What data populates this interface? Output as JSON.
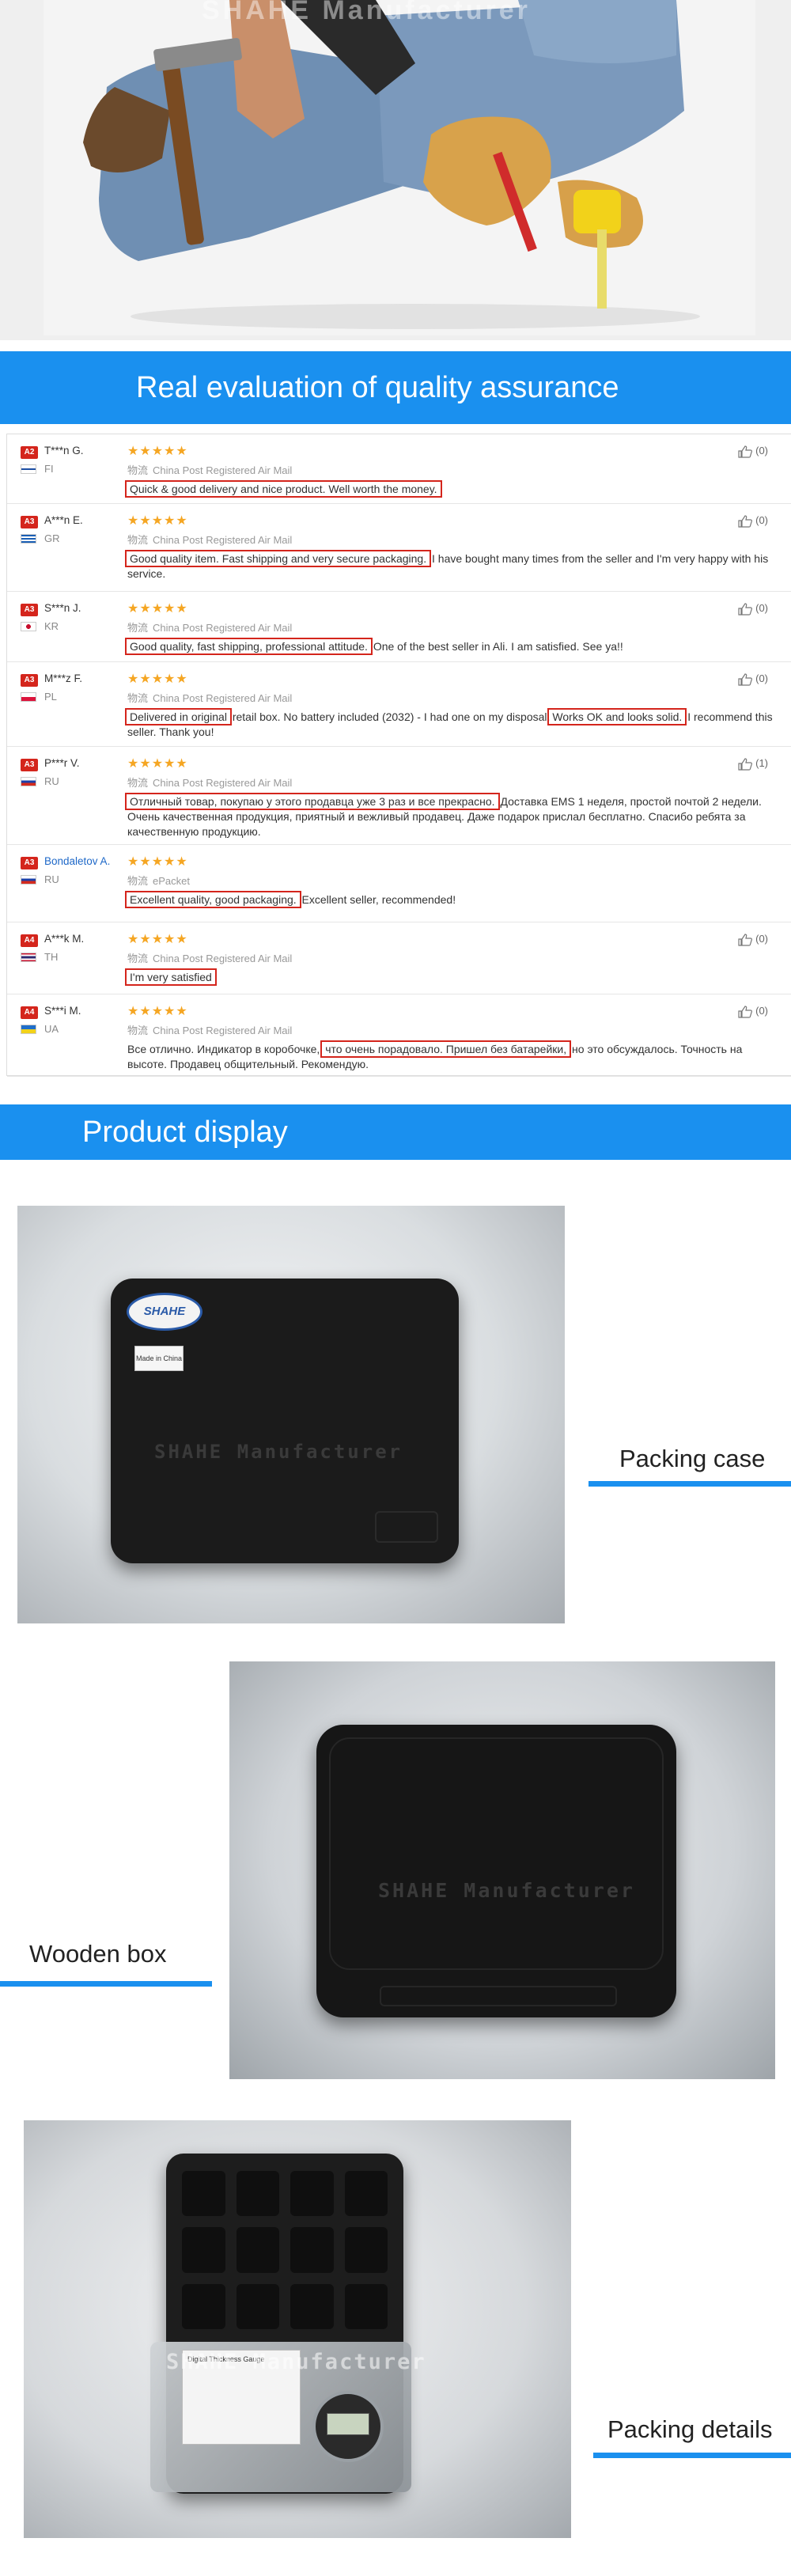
{
  "hero": {
    "watermark": "SHAHE Manufacturer"
  },
  "sections": {
    "reviews_title": "Real evaluation of quality assurance",
    "display_title": "Product display"
  },
  "colors": {
    "accent": "#1a90ef",
    "highlight": "#d4251c",
    "star": "#f5a623"
  },
  "reviews": [
    {
      "badge": "A2",
      "badge_color": "#d4251c",
      "user": "T***n G.",
      "country": "FI",
      "flag": "flag-fi-icon",
      "stars": "★★★★★",
      "ship_label": "物流",
      "shipping": "China Post Registered Air Mail",
      "segments": [
        {
          "t": "Quick & good delivery and nice product. Well worth the money.",
          "hl": true
        }
      ],
      "helpful": "(0)"
    },
    {
      "badge": "A3",
      "badge_color": "#d4251c",
      "user": "A***n E.",
      "country": "GR",
      "flag": "flag-gr-icon",
      "stars": "★★★★★",
      "ship_label": "物流",
      "shipping": "China Post Registered Air Mail",
      "segments": [
        {
          "t": "Good quality item. Fast shipping and very secure packaging.",
          "hl": true
        },
        {
          "t": " I have bought many times from the seller and I'm very happy with his service.",
          "hl": false
        }
      ],
      "helpful": "(0)"
    },
    {
      "badge": "A3",
      "badge_color": "#d4251c",
      "user": "S***n J.",
      "country": "KR",
      "flag": "flag-kr-icon",
      "stars": "★★★★★",
      "ship_label": "物流",
      "shipping": "China Post Registered Air Mail",
      "segments": [
        {
          "t": "Good quality, fast shipping, professional attitude.",
          "hl": true
        },
        {
          "t": " One of the best seller in Ali. I am satisfied. See ya!!",
          "hl": false
        }
      ],
      "helpful": "(0)"
    },
    {
      "badge": "A3",
      "badge_color": "#d4251c",
      "user": "M***z F.",
      "country": "PL",
      "flag": "flag-pl-icon",
      "stars": "★★★★★",
      "ship_label": "物流",
      "shipping": "China Post Registered Air Mail",
      "segments": [
        {
          "t": "Delivered in original",
          "hl": true
        },
        {
          "t": " retail box. No battery included (2032) - I had one on my disposal.",
          "hl": false
        },
        {
          "t": "Works OK and looks solid.",
          "hl": true
        },
        {
          "t": " I recommend this seller. Thank you!",
          "hl": false
        }
      ],
      "helpful": "(0)"
    },
    {
      "badge": "A3",
      "badge_color": "#d4251c",
      "user": "P***r V.",
      "country": "RU",
      "flag": "flag-ru-icon",
      "stars": "★★★★★",
      "ship_label": "物流",
      "shipping": "China Post Registered Air Mail",
      "segments": [
        {
          "t": "Отличный товар, покупаю у этого продавца уже 3 раз и все прекрасно.",
          "hl": true
        },
        {
          "t": " Доставка EMS 1 неделя, простой почтой 2 недели. Очень качественная продукция, приятный и вежливый продавец. Даже подарок прислал бесплатно. Спасибо ребята за качественную продукцию.",
          "hl": false
        }
      ],
      "helpful": "(1)"
    },
    {
      "badge": "A3",
      "badge_color": "#d4251c",
      "user": "Bondaletov A.",
      "country": "RU",
      "flag": "flag-ru-icon",
      "stars": "★★★★★",
      "ship_label": "物流",
      "shipping": "ePacket",
      "segments": [
        {
          "t": " Excellent quality, good packaging.",
          "hl": true
        },
        {
          "t": " Excellent seller, recommended!",
          "hl": false
        }
      ],
      "helpful": ""
    },
    {
      "badge": "A4",
      "badge_color": "#d4251c",
      "user": "A***k M.",
      "country": "TH",
      "flag": "flag-th-icon",
      "stars": "★★★★★",
      "ship_label": "物流",
      "shipping": "China Post Registered Air Mail",
      "segments": [
        {
          "t": "I'm very satisfied",
          "hl": true
        }
      ],
      "helpful": "(0)"
    },
    {
      "badge": "A4",
      "badge_color": "#d4251c",
      "user": "S***i M.",
      "country": "UA",
      "flag": "flag-ua-icon",
      "stars": "★★★★★",
      "ship_label": "物流",
      "shipping": "China Post Registered Air Mail",
      "segments": [
        {
          "t": "Все отлично. Индикатор в коробочке, ",
          "hl": false
        },
        {
          "t": "что очень порадовало. Пришел без батарейки,",
          "hl": true
        },
        {
          "t": " но это обсуждалось. Точность на высоте. Продавец общительный. Рекомендую.",
          "hl": false
        }
      ],
      "helpful": "(0)"
    }
  ],
  "products": [
    {
      "caption": "Packing case",
      "case_text": "SHAHE Manufacturer",
      "logo": "SHAHE",
      "sticker": "Made in China"
    },
    {
      "caption": "Wooden box",
      "case_text": "SHAHE Manufacturer"
    },
    {
      "caption": "Packing details",
      "watermark": "SHAHE Manufacturer",
      "manual": "Digital Thickness Gauge"
    }
  ]
}
